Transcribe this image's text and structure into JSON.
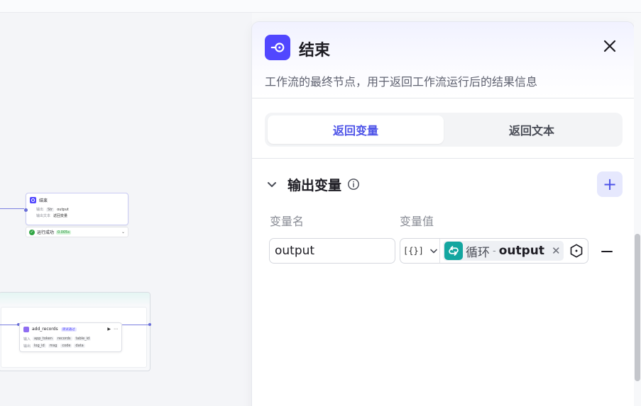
{
  "canvas": {
    "end_node": {
      "title": "结束",
      "row1_label": "输出",
      "row1_tag": "Str",
      "row1_value": "output",
      "row2_label": "输出文本",
      "row2_value": "返回变量",
      "status": "运行成功",
      "time": "0.005s"
    },
    "add_records_node": {
      "title": "add_records",
      "badge": "调试通过",
      "inputs_label": "输入",
      "inputs": [
        "app_token",
        "records",
        "table_id"
      ],
      "outputs_label": "输出",
      "outputs": [
        "log_id",
        "msg",
        "code",
        "data"
      ]
    }
  },
  "panel": {
    "title": "结束",
    "description": "工作流的最终节点，用于返回工作流运行后的结果信息",
    "tabs": [
      {
        "label": "返回变量",
        "active": true
      },
      {
        "label": "返回文本",
        "active": false
      }
    ],
    "section_title": "输出变量",
    "col_name_label": "变量名",
    "col_value_label": "变量值",
    "row": {
      "name": "output",
      "type_glyph": "[{}]",
      "ref_node": "循环",
      "ref_sep": "-",
      "ref_var": "output"
    },
    "accent_color": "#4d53e8",
    "icon_color": "#5147ff",
    "loop_icon_color": "#14a6a0"
  }
}
